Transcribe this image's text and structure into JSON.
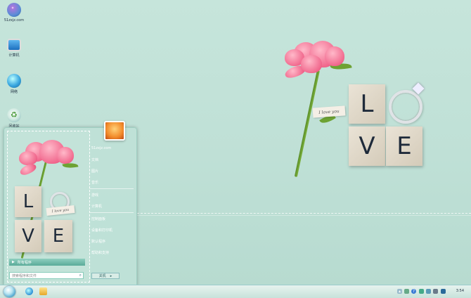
{
  "desktop_icons": [
    {
      "label": "51zxjz.com",
      "icon": "computer-icon"
    },
    {
      "label": "计算机",
      "icon": "monitor-icon"
    },
    {
      "label": "网络",
      "icon": "network-globe-icon"
    },
    {
      "label": "回收站",
      "icon": "recycle-bin-icon"
    }
  ],
  "wallpaper": {
    "note_text": "I love you",
    "tiles": [
      "L",
      "V",
      "E"
    ]
  },
  "start_menu": {
    "left_note_text": "I love you",
    "left_tiles": [
      "L",
      "V",
      "E"
    ],
    "all_programs": "所有程序",
    "search_placeholder": "搜索程序和文件",
    "right_items": [
      "51zxjz.com",
      "文档",
      "图片",
      "音乐",
      "游戏",
      "计算机",
      "控制面板",
      "设备和打印机",
      "默认程序",
      "帮助和支持"
    ],
    "shutdown_label": "关机"
  },
  "taskbar": {
    "clock": "3:54"
  },
  "colors": {
    "desktop_bg": "#bfe0d6",
    "menu_accent": "#5aab99"
  }
}
